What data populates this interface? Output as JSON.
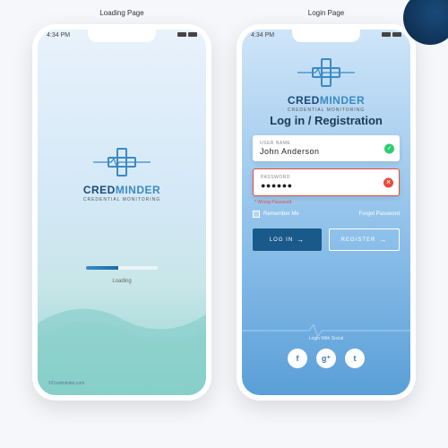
{
  "labels": {
    "loading": "Loading Page",
    "login": "Login Page"
  },
  "status_time": "4:34 PM",
  "brand": {
    "part1": "CRED",
    "part2": "MINDER",
    "tagline": "CREDENTIAL MONITORING"
  },
  "loading": {
    "text": "Loading",
    "footer": "©Credminder.com"
  },
  "login": {
    "title": "Log in / Registration",
    "username": {
      "label": "USER NAME",
      "value": "John Anderson"
    },
    "password": {
      "label": "PASSWORD",
      "value": "●●●●●●",
      "error": "* Wrong Password"
    },
    "remember": "Remember Me",
    "forgot": "Forgot Password",
    "login_btn": "LOG IN",
    "register_btn": "REGISTER",
    "social_label": "Login With Social",
    "social": {
      "fb": "f",
      "gp": "g⁺",
      "tw": "t"
    }
  }
}
